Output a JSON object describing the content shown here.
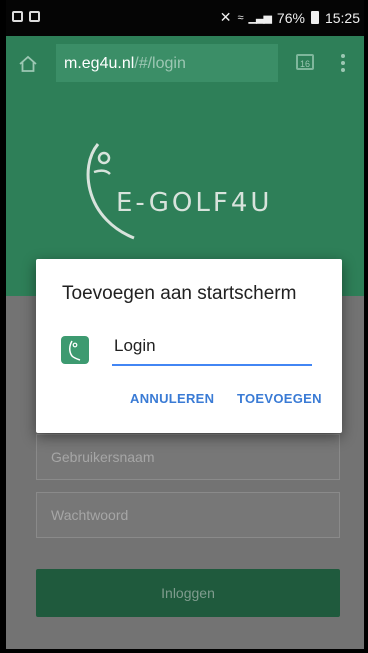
{
  "status_bar": {
    "battery": "76%",
    "time": "15:25"
  },
  "browser": {
    "url_host": "m.eg4u.nl",
    "url_path": "/#/login",
    "tab_count": "16"
  },
  "page": {
    "logo_text": "E-GOLF4U",
    "username_placeholder": "Gebruikersnaam",
    "password_placeholder": "Wachtwoord",
    "login_button": "Inloggen"
  },
  "dialog": {
    "title": "Toevoegen aan startscherm",
    "name_value": "Login",
    "cancel_label": "ANNULEREN",
    "add_label": "TOEVOEGEN"
  },
  "colors": {
    "brand_green": "#2e7f58",
    "accent_blue": "#3a7bd5",
    "input_underline": "#4286f4"
  }
}
